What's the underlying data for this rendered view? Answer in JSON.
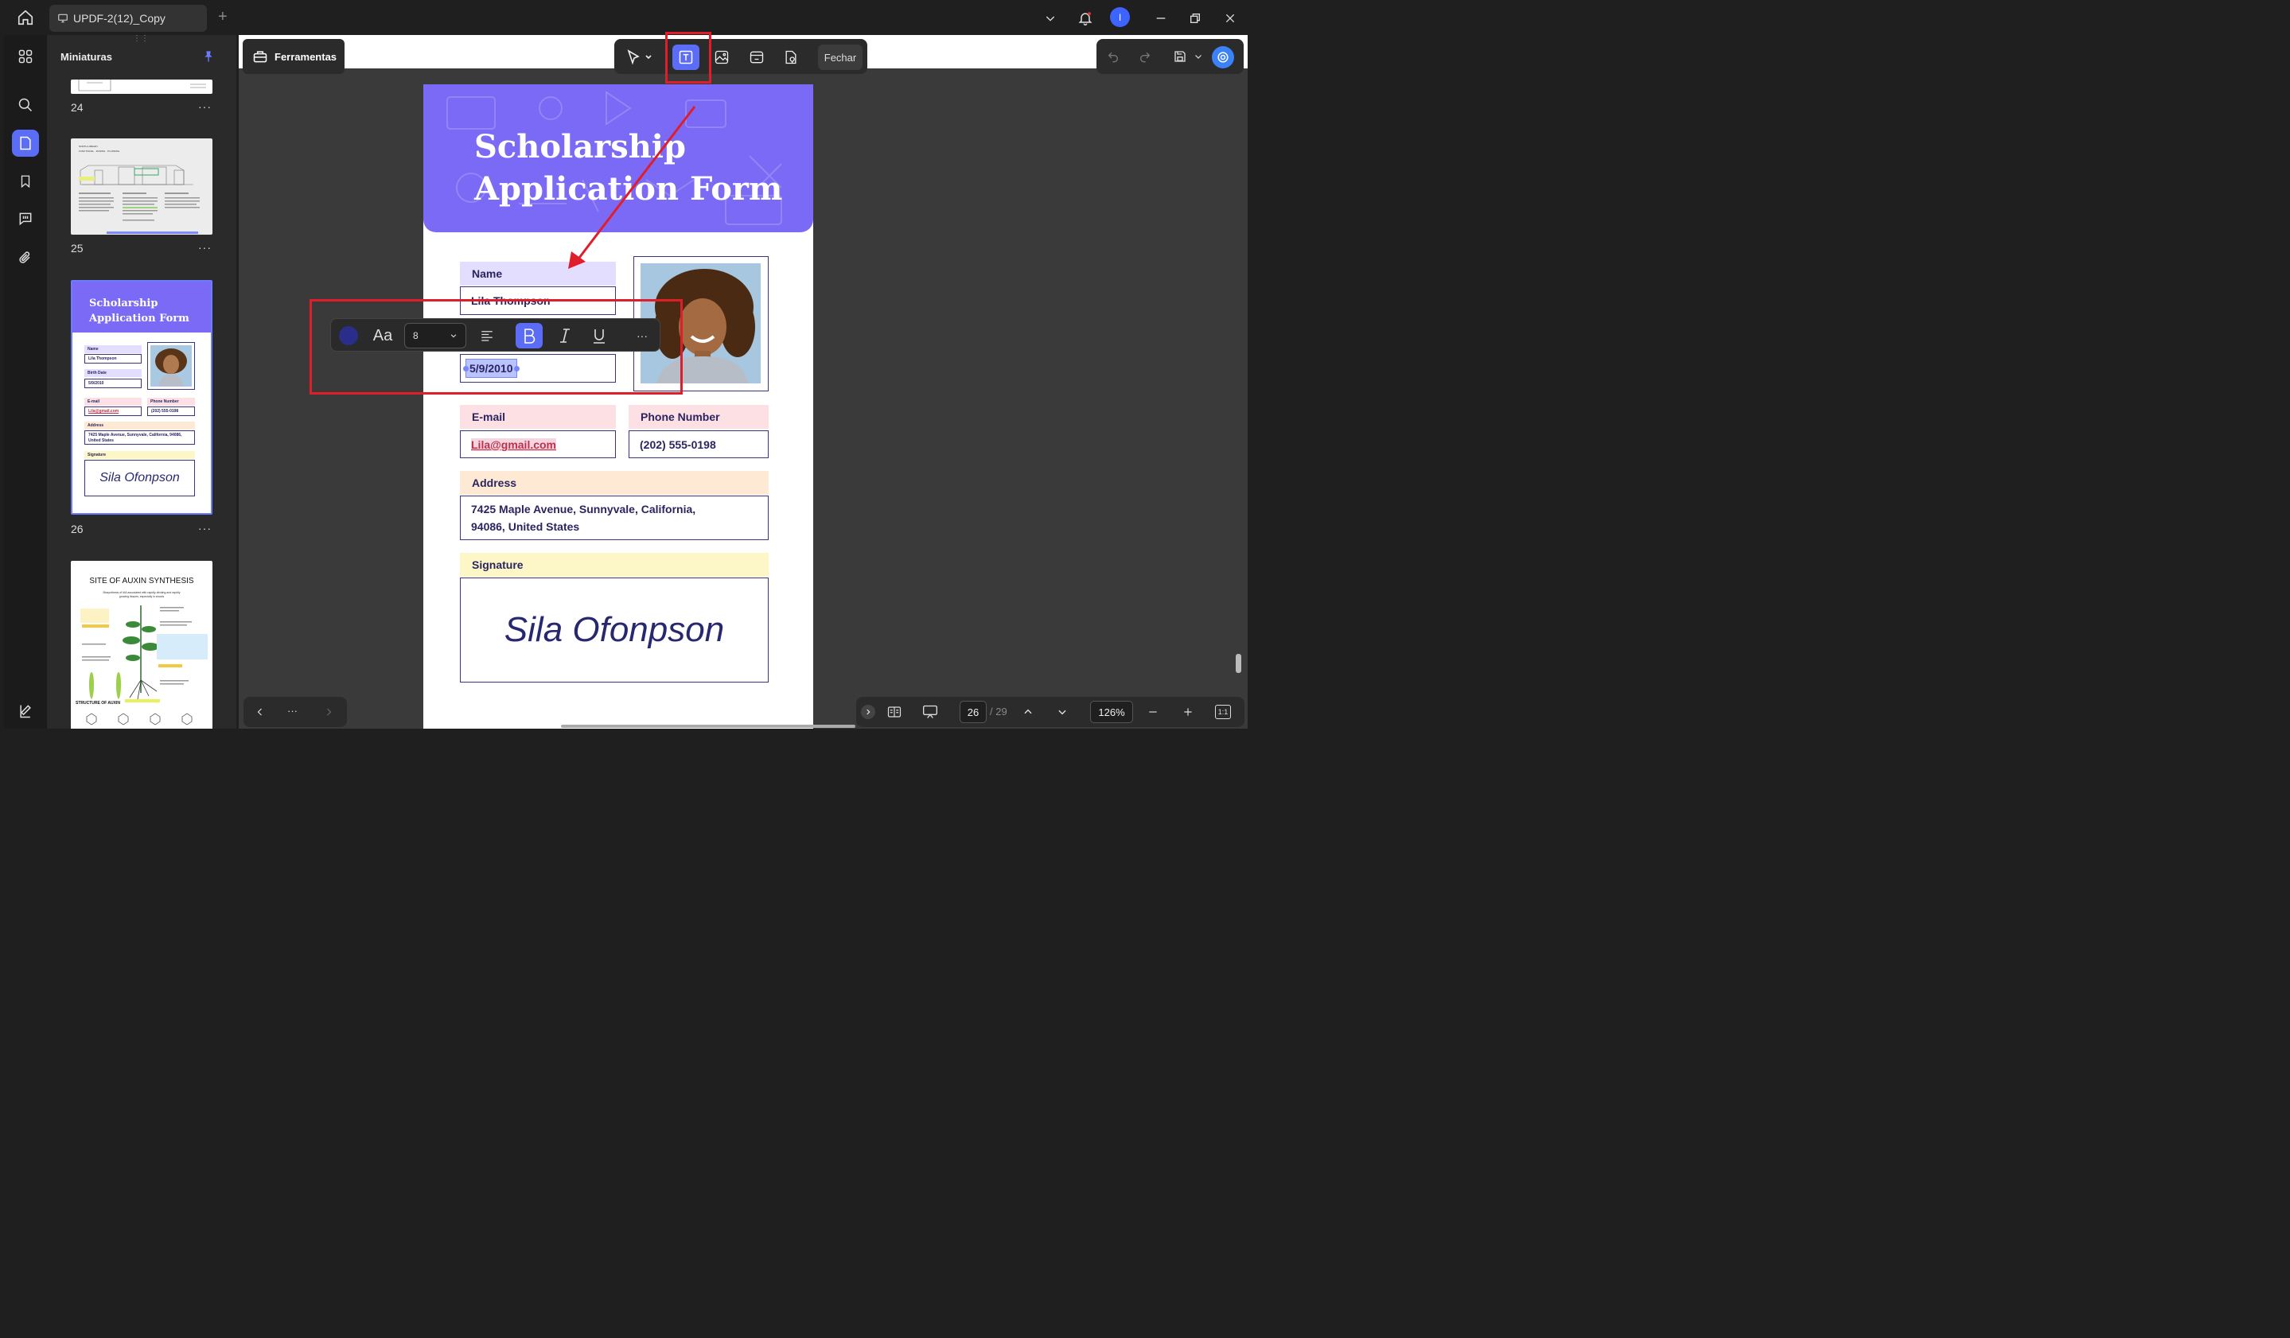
{
  "window": {
    "tab_title": "UPDF-2(12)_Copy",
    "avatar_initial": "I"
  },
  "sidebar": {
    "title": "Miniaturas",
    "pages": [
      {
        "number": "24",
        "more": "···"
      },
      {
        "number": "25",
        "more": "···"
      },
      {
        "number": "26",
        "more": "···"
      }
    ],
    "thumb26": {
      "title_line1": "Scholarship",
      "title_line2": "Application Form",
      "name_label": "Name",
      "name_value": "Lila Thompson",
      "birth_label": "Birth Date",
      "birth_value": "5/9/2010",
      "email_label": "E-mail",
      "email_value": "Lila@gmail.com",
      "phone_label": "Phone Number",
      "phone_value": "(202) 555-0198",
      "address_label": "Address",
      "address_value": "7425 Maple Avenue, Sunnyvale, California, 94086, United States",
      "signature_label": "Signature",
      "signature_value": "Sila Ofonpson"
    },
    "thumb27": {
      "title": "SITE OF AUXIN SYNTHESIS",
      "subtitle": "Biosynthesis of IAA associated with rapidly dividing and rapidly growing tissues, especially in shoots",
      "footer": "STRUCTURE OF AUXIN"
    },
    "thumb25": {
      "heading": "NORTH LIBRARY",
      "sub": "FUNCTIONAL · ZONING · PLANNING"
    }
  },
  "toolbar": {
    "tools_label": "Ferramentas",
    "close_label": "Fechar"
  },
  "document": {
    "title_line1": "Scholarship",
    "title_line2": "Application Form",
    "name_label": "Name",
    "name_value": "Lila Thompson",
    "birth_value": "5/9/2010",
    "email_label": "E-mail",
    "email_value": "Lila@gmail.com",
    "phone_label": "Phone Number",
    "phone_value": "(202) 555-0198",
    "address_label": "Address",
    "address_line1": "7425 Maple Avenue, Sunnyvale, California,",
    "address_line2": "94086, United States",
    "signature_label": "Signature",
    "signature_value": "Sila Ofonpson"
  },
  "text_format_toolbar": {
    "color": "#2b2d8a",
    "font_icon_label": "Aa",
    "font_size": "8",
    "more": "···"
  },
  "bottom_bar": {
    "current_page": "26",
    "total_pages": "/ 29",
    "zoom": "126%",
    "fit_label": "1:1",
    "more": "···"
  },
  "colors": {
    "accent": "#5b6cf6",
    "hero": "#7b6af5",
    "annotation_red": "#e01e2a"
  }
}
